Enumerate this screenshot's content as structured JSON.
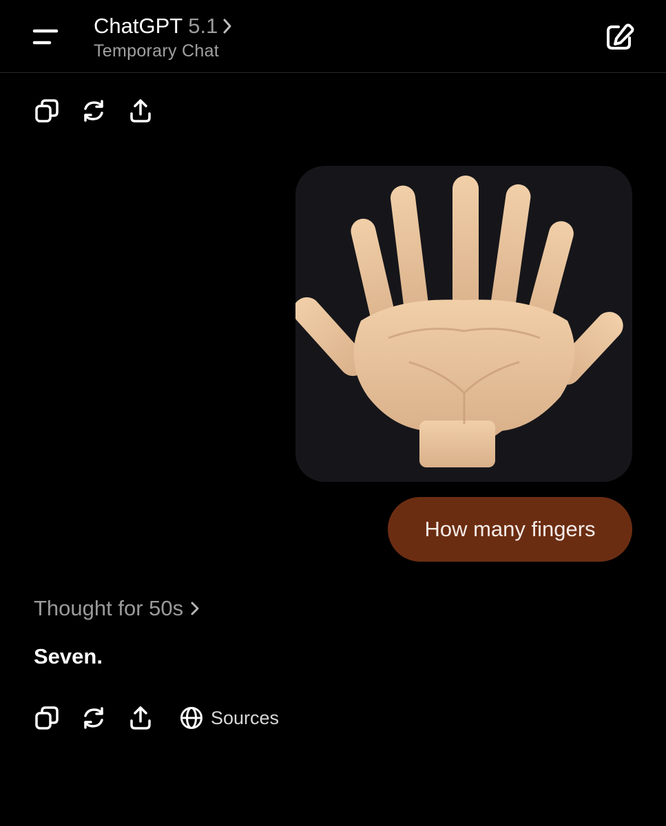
{
  "header": {
    "app_name": "ChatGPT",
    "version": "5.1",
    "subtitle": "Temporary Chat",
    "menu_icon": "hamburger-menu-icon",
    "new_chat_icon": "edit-pencil-icon"
  },
  "top_actions": [
    "copy-icon",
    "regenerate-icon",
    "share-icon"
  ],
  "user_message": {
    "image_description_icon": "hand-emoji-image",
    "text": "How many fingers"
  },
  "assistant_message": {
    "thought_label": "Thought for 50s",
    "answer": "Seven.",
    "actions": [
      "copy-icon",
      "regenerate-icon",
      "share-icon",
      "globe-icon"
    ],
    "sources_label": "Sources"
  },
  "colors": {
    "background": "#000000",
    "user_bubble": "#6b2d12",
    "image_bubble": "#16161a",
    "muted_text": "#9a9a9a"
  }
}
